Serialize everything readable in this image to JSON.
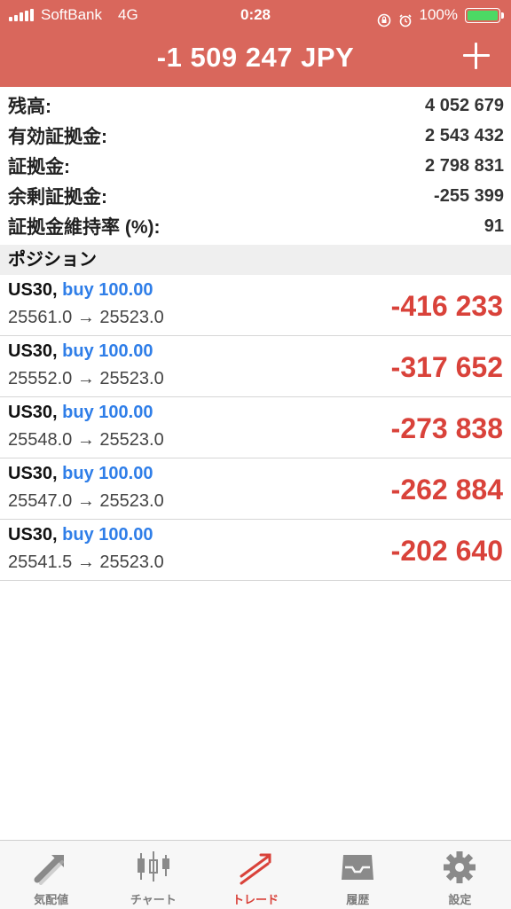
{
  "status_bar": {
    "carrier": "SoftBank",
    "network": "4G",
    "time": "0:28",
    "battery": "100%"
  },
  "header": {
    "title": "-1 509 247 JPY",
    "add_icon": "plus-icon"
  },
  "summary": [
    {
      "label": "残高:",
      "value": "4 052 679"
    },
    {
      "label": "有効証拠金:",
      "value": "2 543 432"
    },
    {
      "label": "証拠金:",
      "value": "2 798 831"
    },
    {
      "label": "余剰証拠金:",
      "value": "-255 399"
    },
    {
      "label": "証拠金維持率 (%):",
      "value": "91"
    }
  ],
  "positions_header": "ポジション",
  "positions": [
    {
      "symbol": "US30,",
      "side": "buy 100.00",
      "prices": "25561.0 → 25523.0",
      "profit": "-416 233"
    },
    {
      "symbol": "US30,",
      "side": "buy 100.00",
      "prices": "25552.0 → 25523.0",
      "profit": "-317 652"
    },
    {
      "symbol": "US30,",
      "side": "buy 100.00",
      "prices": "25548.0 → 25523.0",
      "profit": "-273 838"
    },
    {
      "symbol": "US30,",
      "side": "buy 100.00",
      "prices": "25547.0 → 25523.0",
      "profit": "-262 884"
    },
    {
      "symbol": "US30,",
      "side": "buy 100.00",
      "prices": "25541.5 → 25523.0",
      "profit": "-202 640"
    }
  ],
  "tabs": [
    {
      "label": "気配値",
      "icon": "quotes-arrows-icon"
    },
    {
      "label": "チャート",
      "icon": "candlestick-chart-icon"
    },
    {
      "label": "トレード",
      "icon": "trade-lines-icon",
      "active": true
    },
    {
      "label": "履歴",
      "icon": "history-tray-icon"
    },
    {
      "label": "設定",
      "icon": "gear-icon"
    }
  ],
  "colors": {
    "header_bg": "#d9675c",
    "profit_negative": "#d9423a",
    "side_blue": "#2f7ee8",
    "tab_active": "#d9423a"
  }
}
